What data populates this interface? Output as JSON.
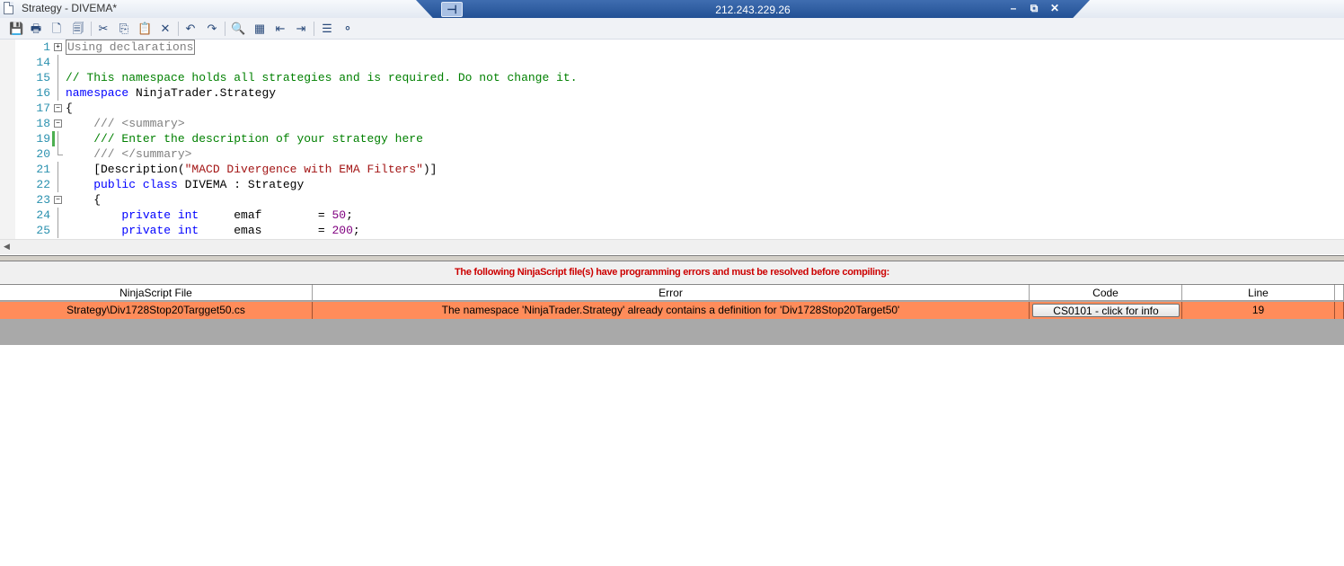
{
  "window": {
    "title": "Strategy - DIVEMA*",
    "icon": "document-icon"
  },
  "remote_bar": {
    "ip": "212.243.229.26",
    "pin_glyph": "⊣",
    "minimize_glyph": "–",
    "restore_glyph": "⧉",
    "close_glyph": "✕"
  },
  "toolbar": {
    "items": [
      {
        "name": "save-icon",
        "glyph": "💾"
      },
      {
        "name": "print-icon",
        "glyph": "🖶"
      },
      {
        "name": "print-preview-icon",
        "glyph": "🗋"
      },
      {
        "name": "page-setup-icon",
        "glyph": "🗐"
      },
      {
        "name": "cut-icon",
        "glyph": "✂"
      },
      {
        "name": "copy-icon",
        "glyph": "⎘"
      },
      {
        "name": "paste-icon",
        "glyph": "📋"
      },
      {
        "name": "delete-icon",
        "glyph": "✕"
      },
      {
        "name": "undo-icon",
        "glyph": "↶"
      },
      {
        "name": "redo-icon",
        "glyph": "↷"
      },
      {
        "name": "find-icon",
        "glyph": "🔍"
      },
      {
        "name": "replace-icon",
        "glyph": "▦"
      },
      {
        "name": "outdent-icon",
        "glyph": "⇤"
      },
      {
        "name": "indent-icon",
        "glyph": "⇥"
      },
      {
        "name": "comment-icon",
        "glyph": "☰"
      },
      {
        "name": "uncomment-icon",
        "glyph": "⚬"
      }
    ]
  },
  "editor": {
    "lines": [
      {
        "num": "1",
        "fold": "plus",
        "parts": [
          {
            "t": "Using declarations",
            "c": "boxed"
          }
        ]
      },
      {
        "num": "14",
        "fold": "line",
        "parts": []
      },
      {
        "num": "15",
        "fold": "line",
        "parts": [
          {
            "t": "// This namespace holds all strategies and is required. Do not change it.",
            "c": "cm"
          }
        ]
      },
      {
        "num": "16",
        "fold": "line",
        "parts": [
          {
            "t": "namespace",
            "c": "kw"
          },
          {
            "t": " NinjaTrader.Strategy",
            "c": ""
          }
        ]
      },
      {
        "num": "17",
        "fold": "minus",
        "parts": [
          {
            "t": "{",
            "c": ""
          }
        ]
      },
      {
        "num": "18",
        "fold": "minus",
        "parts": [
          {
            "t": "    /// ",
            "c": "xml"
          },
          {
            "t": "<summary>",
            "c": "xml"
          }
        ]
      },
      {
        "num": "19",
        "fold": "line",
        "changed": true,
        "parts": [
          {
            "t": "    /// Enter the description of your strategy here",
            "c": "cm"
          }
        ]
      },
      {
        "num": "20",
        "fold": "end",
        "parts": [
          {
            "t": "    /// ",
            "c": "xml"
          },
          {
            "t": "</summary>",
            "c": "xml"
          }
        ]
      },
      {
        "num": "21",
        "fold": "line",
        "parts": [
          {
            "t": "    [Description(",
            "c": ""
          },
          {
            "t": "\"MACD Divergence with EMA Filters\"",
            "c": "str"
          },
          {
            "t": ")]",
            "c": ""
          }
        ]
      },
      {
        "num": "22",
        "fold": "line",
        "parts": [
          {
            "t": "    ",
            "c": ""
          },
          {
            "t": "public class",
            "c": "kw"
          },
          {
            "t": " DIVEMA : Strategy",
            "c": ""
          }
        ]
      },
      {
        "num": "23",
        "fold": "minus",
        "parts": [
          {
            "t": "    {",
            "c": ""
          }
        ]
      },
      {
        "num": "24",
        "fold": "line",
        "parts": [
          {
            "t": "        ",
            "c": ""
          },
          {
            "t": "private int",
            "c": "kw"
          },
          {
            "t": "     emaf        = ",
            "c": ""
          },
          {
            "t": "50",
            "c": "num"
          },
          {
            "t": ";",
            "c": ""
          }
        ]
      },
      {
        "num": "25",
        "fold": "line",
        "parts": [
          {
            "t": "        ",
            "c": ""
          },
          {
            "t": "private int",
            "c": "kw"
          },
          {
            "t": "     emas        = ",
            "c": ""
          },
          {
            "t": "200",
            "c": "num"
          },
          {
            "t": ";",
            "c": ""
          }
        ]
      }
    ],
    "scroll_left_glyph": "◀"
  },
  "errors": {
    "message": "The following NinjaScript file(s) have programming errors and must be resolved before compiling:",
    "columns": [
      "NinjaScript File",
      "Error",
      "Code",
      "Line"
    ],
    "rows": [
      {
        "file": "Strategy\\Div1728Stop20Targget50.cs",
        "error": "The namespace 'NinjaTrader.Strategy' already contains a definition for 'Div1728Stop20Target50'",
        "code": "CS0101 - click for info",
        "line": "19"
      }
    ],
    "row_color": "#ff8c5a"
  }
}
